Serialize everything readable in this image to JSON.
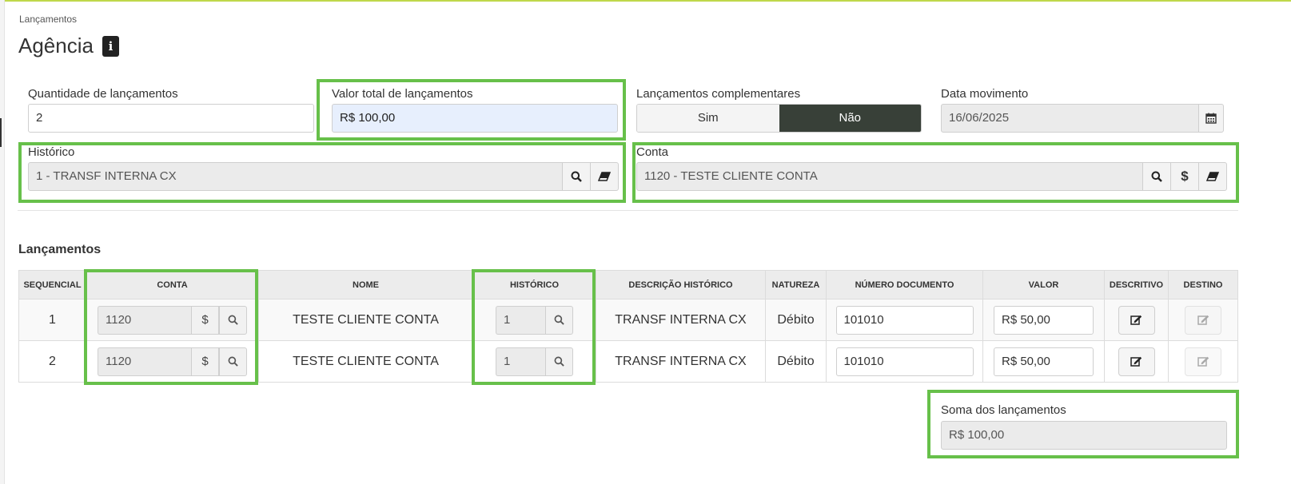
{
  "breadcrumb": "Lançamentos",
  "page_title": "Agência",
  "form": {
    "quantidade": {
      "label": "Quantidade de lançamentos",
      "value": "2"
    },
    "valor_total": {
      "label": "Valor total de lançamentos",
      "value": "R$ 100,00"
    },
    "complementares": {
      "label": "Lançamentos complementares",
      "options": [
        "Sim",
        "Não"
      ],
      "selected": "Não"
    },
    "data_movimento": {
      "label": "Data movimento",
      "value": "16/06/2025"
    },
    "historico": {
      "label": "Histórico",
      "value": "1 - TRANSF INTERNA CX"
    },
    "conta": {
      "label": "Conta",
      "value": "1120 - TESTE CLIENTE CONTA"
    }
  },
  "section_title": "Lançamentos",
  "table": {
    "headers": [
      "SEQUENCIAL",
      "CONTA",
      "NOME",
      "HISTÓRICO",
      "DESCRIÇÃO HISTÓRICO",
      "NATUREZA",
      "NÚMERO DOCUMENTO",
      "VALOR",
      "DESCRITIVO",
      "DESTINO"
    ],
    "rows": [
      {
        "seq": "1",
        "conta": "1120",
        "nome": "TESTE CLIENTE CONTA",
        "historico": "1",
        "descricao": "TRANSF INTERNA CX",
        "natureza": "Débito",
        "documento": "101010",
        "valor": "R$ 50,00"
      },
      {
        "seq": "2",
        "conta": "1120",
        "nome": "TESTE CLIENTE CONTA",
        "historico": "1",
        "descricao": "TRANSF INTERNA CX",
        "natureza": "Débito",
        "documento": "101010",
        "valor": "R$ 50,00"
      }
    ]
  },
  "soma": {
    "label": "Soma dos lançamentos",
    "value": "R$ 100,00"
  },
  "icons": {
    "dollar": "$"
  },
  "colors": {
    "highlight": "#67c04a",
    "toggle_active": "#384038",
    "top_accent": "#bfd84a"
  }
}
